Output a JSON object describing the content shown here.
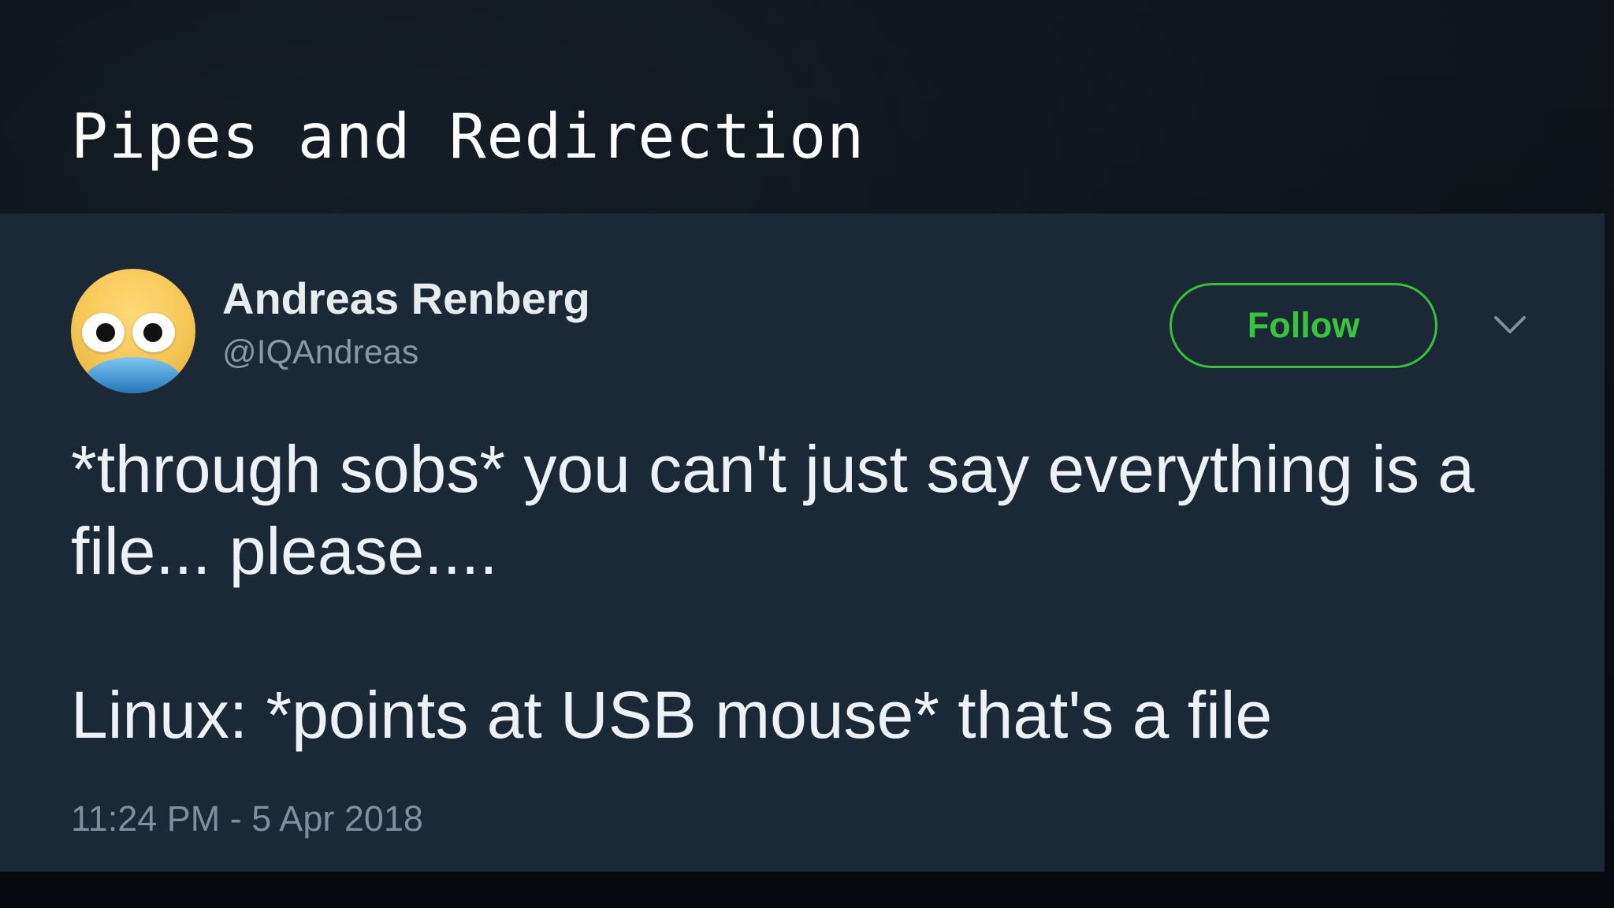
{
  "slide": {
    "title": "Pipes and Redirection"
  },
  "tweet": {
    "author": {
      "display_name": "Andreas Renberg",
      "handle": "@IQAndreas",
      "avatar_icon": "googly-eyes-avatar-icon"
    },
    "follow_label": "Follow",
    "menu_icon": "chevron-down-icon",
    "text_paragraphs": [
      "*through sobs* you can't just say everything is a file... please....",
      "Linux: *points at USB mouse* that's a file"
    ],
    "timestamp": "11:24 PM - 5 Apr 2018"
  },
  "colors": {
    "card_background": "#1b2836",
    "follow_green": "#35c13a",
    "muted_text": "#8899a6",
    "primary_text": "#eef2f5"
  }
}
